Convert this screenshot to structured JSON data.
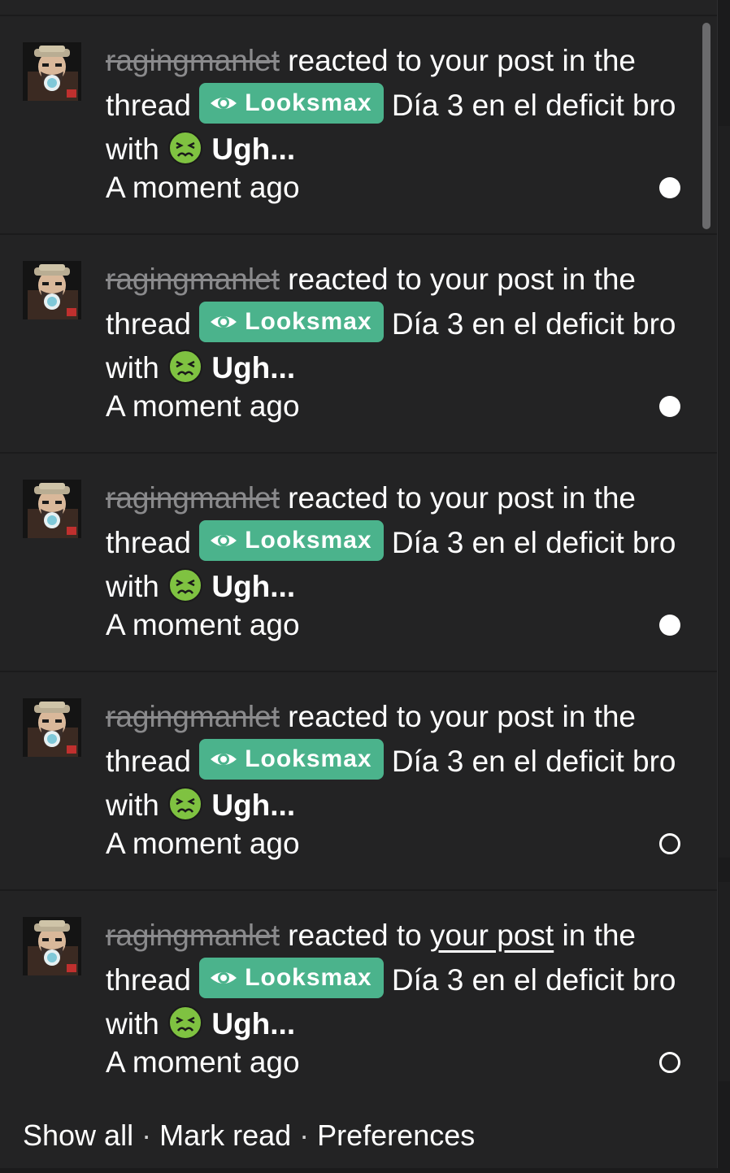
{
  "notifications": [
    {
      "username": "ragingmanlet",
      "action_text": " reacted to ",
      "post_link": "your post",
      "in_thread_text": " in the thread ",
      "prefix_label": "Looksmax",
      "thread_title": "Día 3 en el deficit bro",
      "with_text": " with ",
      "reaction_label": "Ugh...",
      "time": "A moment ago",
      "status": "unread"
    },
    {
      "username": "ragingmanlet",
      "action_text": " reacted to ",
      "post_link": "your post",
      "in_thread_text": " in the thread ",
      "prefix_label": "Looksmax",
      "thread_title": "Día 3 en el deficit bro",
      "with_text": " with ",
      "reaction_label": "Ugh...",
      "time": "A moment ago",
      "status": "unread"
    },
    {
      "username": "ragingmanlet",
      "action_text": " reacted to ",
      "post_link": "your post",
      "in_thread_text": " in the thread ",
      "prefix_label": "Looksmax",
      "thread_title": "Día 3 en el deficit bro",
      "with_text": " with ",
      "reaction_label": "Ugh...",
      "time": "A moment ago",
      "status": "unread"
    },
    {
      "username": "ragingmanlet",
      "action_text": " reacted to ",
      "post_link": "your post",
      "in_thread_text": " in the thread ",
      "prefix_label": "Looksmax",
      "thread_title": "Día 3 en el deficit bro",
      "with_text": " with ",
      "reaction_label": "Ugh...",
      "time": "A moment ago",
      "status": "read"
    },
    {
      "username": "ragingmanlet",
      "action_text": " reacted to ",
      "post_link": "your post",
      "in_thread_text": " in the thread ",
      "prefix_label": "Looksmax",
      "thread_title": "Día 3 en el deficit bro",
      "with_text": " with ",
      "reaction_label": "Ugh...",
      "time": "A moment ago",
      "status": "read"
    }
  ],
  "footer": {
    "show_all": "Show all",
    "separator": "·",
    "mark_read": "Mark read",
    "preferences": "Preferences"
  },
  "colors": {
    "background": "#232324",
    "prefix_badge": "#4bb38c",
    "username_muted": "#8a8a8c"
  },
  "icons": {
    "prefix": "eye-icon",
    "reaction": "nauseated-face-emoji",
    "unread": "filled-circle",
    "read": "hollow-circle"
  }
}
